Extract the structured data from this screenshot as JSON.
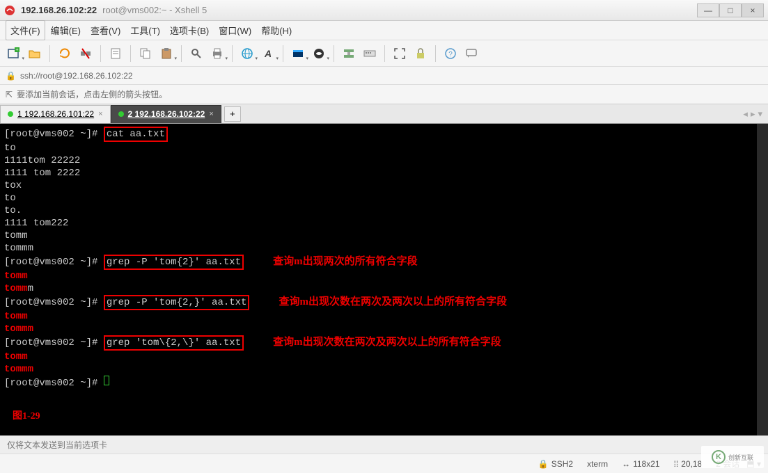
{
  "title": {
    "main": "192.168.26.102:22",
    "sub": "root@vms002:~ - Xshell 5"
  },
  "menubar": {
    "file": "文件(F)",
    "edit": "编辑(E)",
    "view": "查看(V)",
    "tools": "工具(T)",
    "tab": "选项卡(B)",
    "window": "窗口(W)",
    "help": "帮助(H)"
  },
  "addressbar": {
    "url": "ssh://root@192.168.26.102:22"
  },
  "hintbar": {
    "text": "要添加当前会话，点击左侧的箭头按钮。"
  },
  "tabs": {
    "t1": {
      "label": "1 192.168.26.101:22"
    },
    "t2": {
      "label": "2 192.168.26.102:22"
    },
    "add": "+"
  },
  "terminal": {
    "p1": "[root@vms002 ~]# ",
    "cmd1": "cat aa.txt",
    "l1": "to",
    "l2": "1111tom 22222",
    "l3": "1111 tom 2222",
    "l4": "tox",
    "l5": "to",
    "l6": "to.",
    "l7": "1111 tom222",
    "l8": "tomm",
    "l9": "tommm",
    "p2": "[root@vms002 ~]# ",
    "cmd2": "grep -P 'tom{2}' aa.txt",
    "a2": "查询m出现两次的所有符合字段",
    "r2a_pre": "tomm",
    "r2b_pre": "tomm",
    "r2b_suf": "m",
    "p3": "[root@vms002 ~]# ",
    "cmd3": "grep -P 'tom{2,}' aa.txt",
    "a3": "查询m出现次数在两次及两次以上的所有符合字段",
    "r3a": "tomm",
    "r3b": "tommm",
    "p4": "[root@vms002 ~]# ",
    "cmd4": "grep 'tom\\{2,\\}' aa.txt",
    "a4": "查询m出现次数在两次及两次以上的所有符合字段",
    "r4a": "tomm",
    "r4b": "tommm",
    "p5": "[root@vms002 ~]# ",
    "figlabel": "图1-29"
  },
  "statushint": {
    "text": "仅将文本发送到当前选项卡"
  },
  "statusbar": {
    "proto": "SSH2",
    "term": "xterm",
    "size": "118x21",
    "cursor": "20,18",
    "sessions": "2 会话"
  },
  "watermark": {
    "brand": "创新互联"
  }
}
